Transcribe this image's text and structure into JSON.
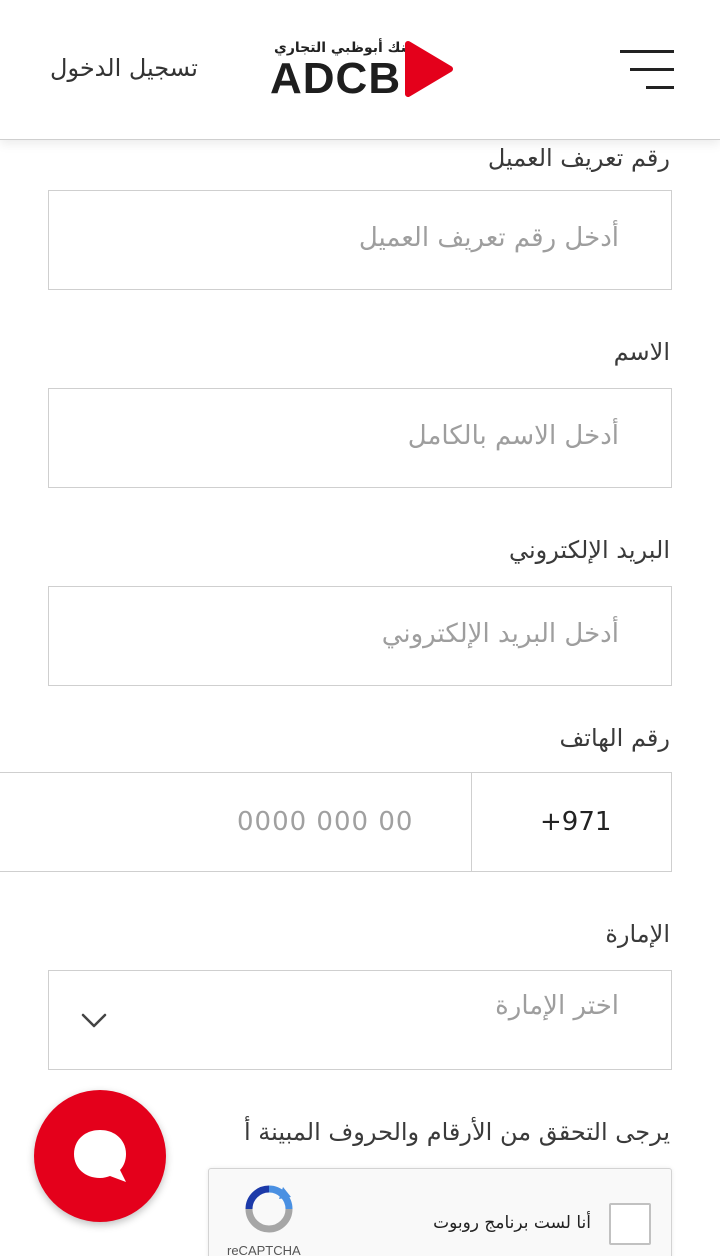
{
  "header": {
    "login_label": "تسجيل الدخول",
    "logo_arabic": "بنك أبوظبي التجاري",
    "logo_english": "ADCB",
    "brand_color": "#e4001b"
  },
  "form": {
    "customer_id": {
      "label": "رقم تعريف العميل",
      "placeholder": "أدخل رقم تعريف العميل"
    },
    "name": {
      "label": "الاسم",
      "placeholder": "أدخل الاسم بالكامل"
    },
    "email": {
      "label": "البريد الإلكتروني",
      "placeholder": "أدخل البريد الإلكتروني"
    },
    "phone": {
      "label": "رقم الهاتف",
      "country_code": "+971",
      "placeholder": "0000 000 00"
    },
    "emirate": {
      "label": "الإمارة",
      "placeholder": "اختر الإمارة"
    },
    "captcha_note": "يرجى التحقق من الأرقام والحروف المبينة أ"
  },
  "recaptcha": {
    "checkbox_label": "أنا لست برنامج روبوت",
    "brand": "reCAPTCHA"
  },
  "icons": {
    "menu": "hamburger-menu-icon",
    "chat": "chat-bubble-icon",
    "chevron": "chevron-down-icon"
  }
}
